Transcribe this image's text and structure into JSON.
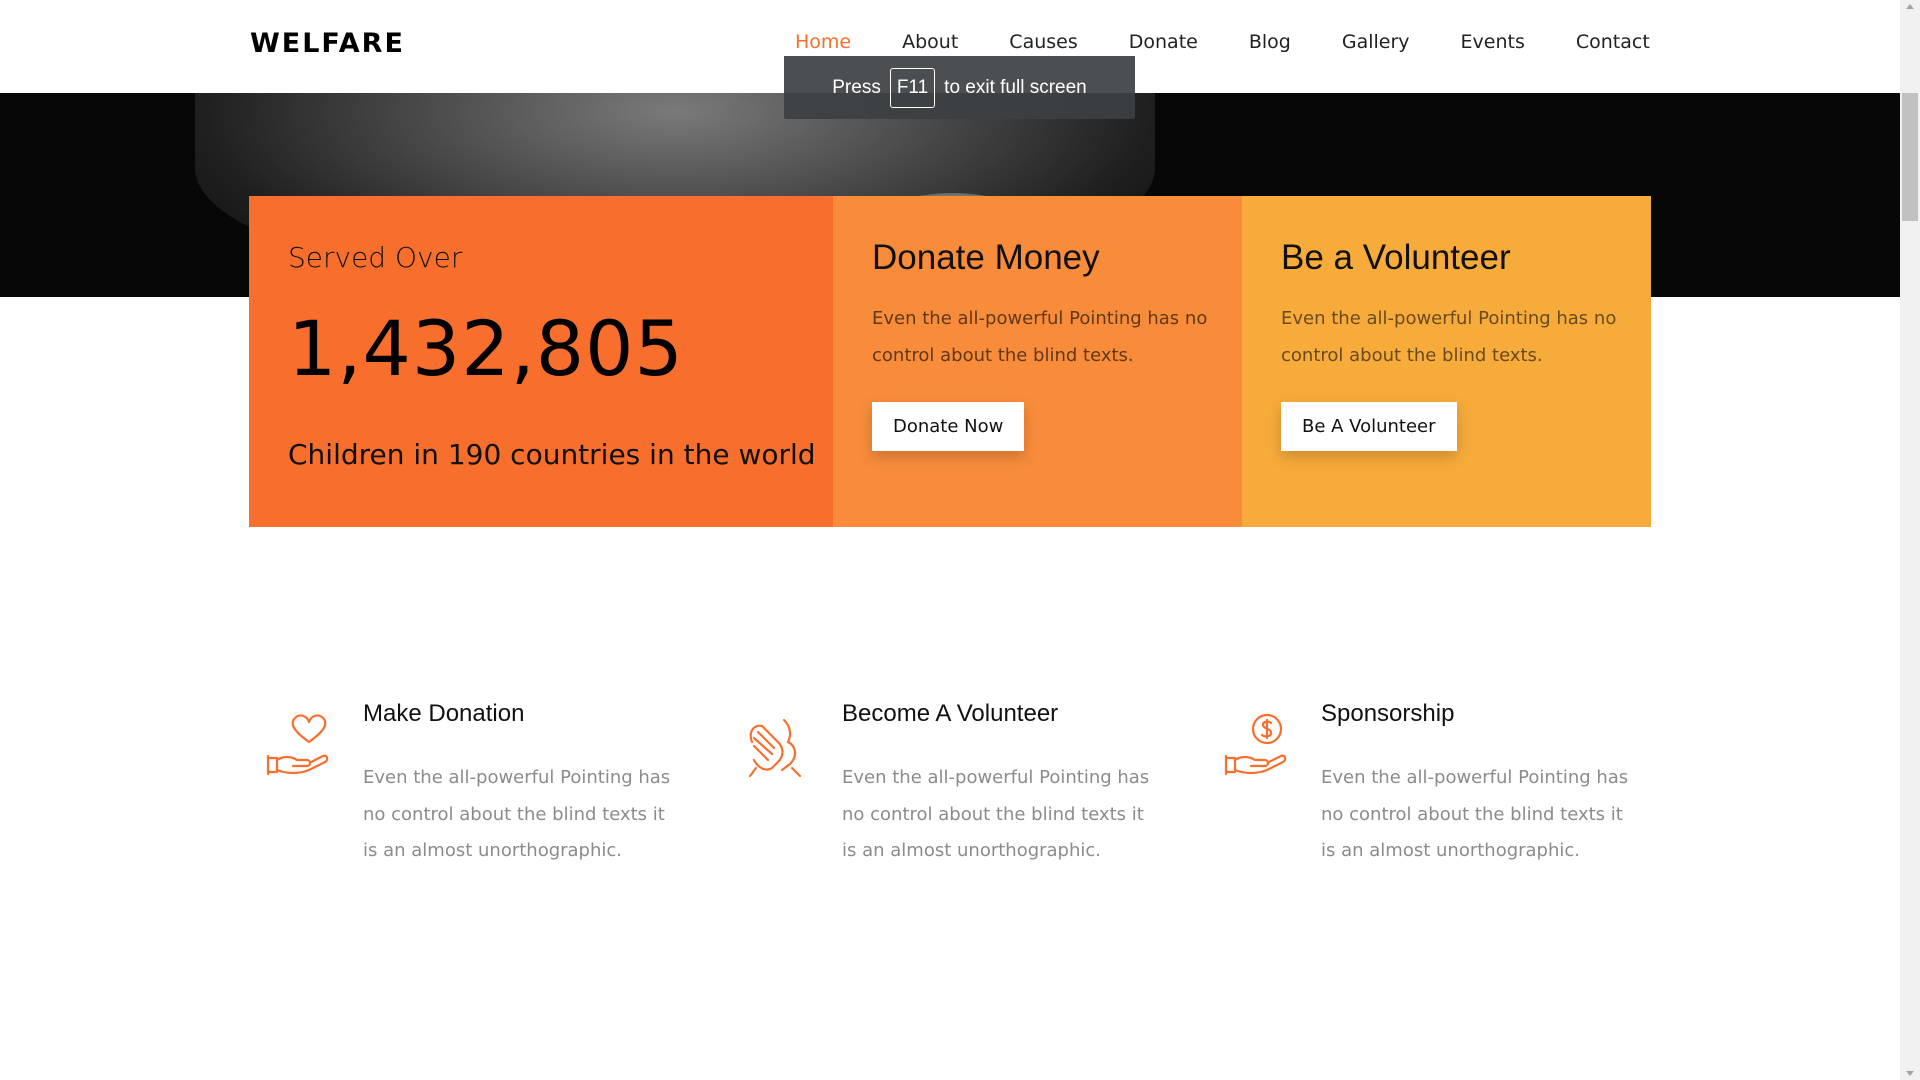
{
  "brand": "WELFARE",
  "nav": {
    "items": [
      {
        "label": "Home",
        "active": true
      },
      {
        "label": "About",
        "active": false
      },
      {
        "label": "Causes",
        "active": false
      },
      {
        "label": "Donate",
        "active": false
      },
      {
        "label": "Blog",
        "active": false
      },
      {
        "label": "Gallery",
        "active": false
      },
      {
        "label": "Events",
        "active": false
      },
      {
        "label": "Contact",
        "active": false
      }
    ]
  },
  "fullscreen_notice": {
    "before": "Press",
    "key": "F11",
    "after": "to exit full screen"
  },
  "stats": {
    "served_label": "Served Over",
    "number": "1,432,805",
    "subtitle": "Children in 190 countries in the world"
  },
  "donate_card": {
    "title": "Donate Money",
    "text": "Even the all-powerful Pointing has no control about the blind texts.",
    "button": "Donate Now"
  },
  "volunteer_card": {
    "title": "Be a Volunteer",
    "text": "Even the all-powerful Pointing has no control about the blind texts.",
    "button": "Be A Volunteer"
  },
  "features": [
    {
      "title": "Make Donation",
      "text": "Even the all-powerful Pointing has no control about the blind texts it is an almost unorthographic.",
      "icon": "hand-heart-icon"
    },
    {
      "title": "Become A Volunteer",
      "text": "Even the all-powerful Pointing has no control about the blind texts it is an almost unorthographic.",
      "icon": "helping-hands-icon"
    },
    {
      "title": "Sponsorship",
      "text": "Even the all-powerful Pointing has no control about the blind texts it is an almost unorthographic.",
      "icon": "hand-coin-icon"
    }
  ],
  "colors": {
    "accent": "#f86f2d",
    "card_donate": "#f88c3b",
    "card_volunteer": "#f7ab3a",
    "icon": "#f86f2d"
  }
}
